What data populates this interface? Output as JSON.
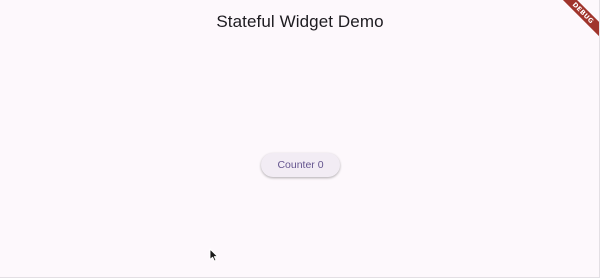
{
  "app_bar": {
    "title": "Stateful Widget Demo"
  },
  "main": {
    "counter_button_label": "Counter 0"
  },
  "debug_banner": {
    "label": "DEBUG"
  },
  "colors": {
    "background": "#fdf8fc",
    "button_background": "#f2ecf4",
    "button_text": "#65558f",
    "debug_ribbon": "#a0342c"
  },
  "icons": {
    "cursor": "mouse-pointer-icon"
  }
}
